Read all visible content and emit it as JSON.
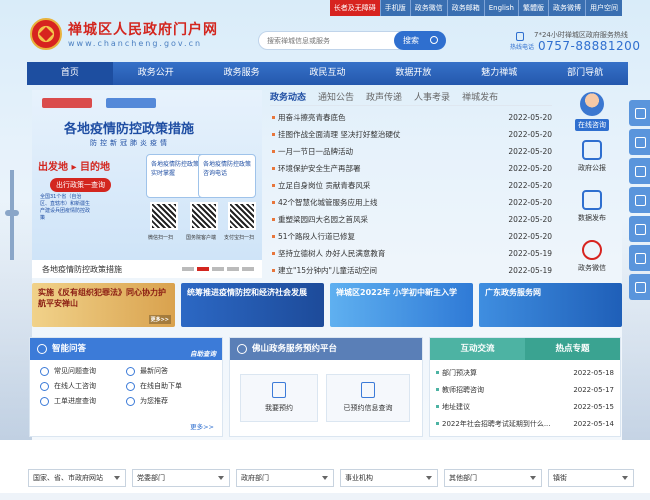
{
  "header": {
    "title": "禅城区人民政府门户网",
    "domain": "www.chancheng.gov.cn",
    "top_links": {
      "care": "长者及无障碍",
      "mobile": "手机版",
      "wechat": "政务微信",
      "mail": "政务邮箱",
      "english": "English",
      "traditional": "繁體版",
      "weibo": "政务微博",
      "user": "用户空间"
    },
    "search": {
      "placeholder": "搜索禅城信息或服务",
      "button": "搜索"
    },
    "hotline": {
      "label": "7*24小时禅城区政府服务热线",
      "mini": "热线电话",
      "number": "0757-88881200"
    }
  },
  "nav": [
    "首页",
    "政务公开",
    "政务服务",
    "政民互动",
    "数据开放",
    "魅力禅城",
    "部门导航"
  ],
  "slider": {
    "caption": "各地疫情防控政策措施",
    "headline": "各地疫情防控政策措施",
    "subline": "防控新冠肺炎疫情",
    "route": "出发地 ▸ 目的地",
    "query": "出行政策一查询",
    "box1": "各地疫情防控政策实时掌握",
    "box2": "各地疫情防控政策咨询电话",
    "note": "全国31个省（自治区、直辖市）和新疆生产建设兵团疫情防控政策",
    "qr_labels": [
      "微信扫一扫",
      "国务院客户端",
      "支付宝扫一扫"
    ]
  },
  "news": {
    "tabs": [
      "政务动态",
      "通知公告",
      "政声传递",
      "人事考录",
      "禅城发布"
    ],
    "items": [
      {
        "title": "用奋斗擦亮青春底色",
        "date": "2022-05-20"
      },
      {
        "title": "挂图作战全面清理 坚决打好整治硬仗",
        "date": "2022-05-20"
      },
      {
        "title": "一月一节日一品牌活动",
        "date": "2022-05-20"
      },
      {
        "title": "环境保护安全生产再部署",
        "date": "2022-05-20"
      },
      {
        "title": "立足自身岗位 贡献青春风采",
        "date": "2022-05-20"
      },
      {
        "title": "42个智慧化城管服务应用上线",
        "date": "2022-05-20"
      },
      {
        "title": "重塑梁园四大名园之首风采",
        "date": "2022-05-20"
      },
      {
        "title": "51个路段人行道已修复",
        "date": "2022-05-20"
      },
      {
        "title": "坚持立德树人 办好人民满意教育",
        "date": "2022-05-19"
      },
      {
        "title": "建立\"15分钟内\"儿童活动空间",
        "date": "2022-05-19"
      }
    ]
  },
  "quick": [
    "在线咨询",
    "政府公报",
    "数据发布",
    "政务微信"
  ],
  "banners": [
    {
      "text": "实施《反有组织犯罪法》同心协力护航平安禅山",
      "more": "更多>>"
    },
    {
      "text": "统筹推进疫情防控和经济社会发展",
      "more": ""
    },
    {
      "text": "禅城区2022年 小学初中新生入学",
      "more": ""
    },
    {
      "text": "广东政务服务网",
      "more": ""
    }
  ],
  "panels": {
    "qa": {
      "title": "智能问答",
      "tag": "自助查询",
      "items": [
        "常见问题查询",
        "最新问答",
        "在线人工咨询",
        "在线自助下单",
        "工单进度查询",
        "为您推荐"
      ],
      "more": "更多>>"
    },
    "booking": {
      "title": "佛山政务服务预约平台",
      "items": [
        "我要预约",
        "已预约信息查询"
      ]
    },
    "interact": {
      "tabs": [
        "互动交流",
        "热点专题"
      ],
      "items": [
        {
          "title": "部门预决算",
          "date": "2022-05-18"
        },
        {
          "title": "教师招聘咨询",
          "date": "2022-05-17"
        },
        {
          "title": "地址建议",
          "date": "2022-05-15"
        },
        {
          "title": "2022年社会招聘考试延期到什么...",
          "date": "2022-05-14"
        }
      ]
    }
  },
  "footer": {
    "selects": [
      "国家、省、市政府网站",
      "党委部门",
      "政府部门",
      "事业机构",
      "其他部门",
      "镇街"
    ]
  },
  "colors": {
    "brand": "#2458ad",
    "accent": "#d3261f",
    "teal": "#4db3a3"
  }
}
